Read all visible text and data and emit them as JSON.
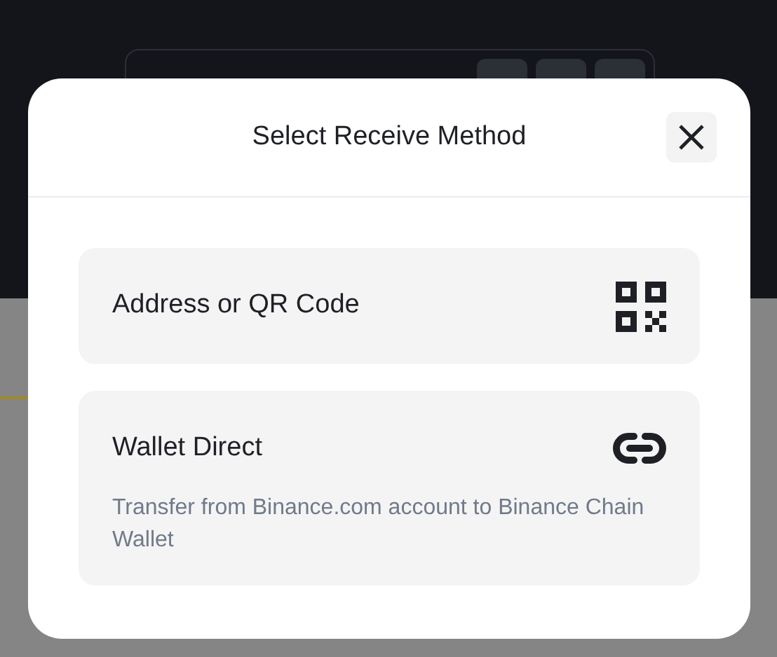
{
  "dialog": {
    "title": "Select Receive Method"
  },
  "options": [
    {
      "kind": "qr",
      "title": "Address or QR Code"
    },
    {
      "kind": "link",
      "title": "Wallet Direct",
      "description": "Transfer from Binance.com account to Binance Chain Wallet"
    }
  ]
}
